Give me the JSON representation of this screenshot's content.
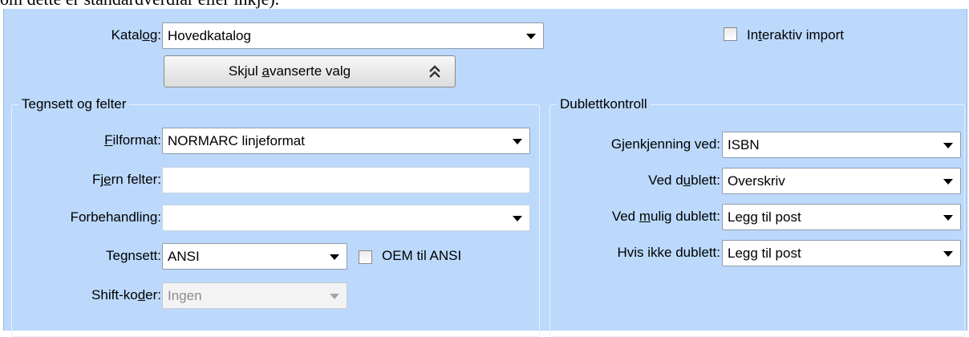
{
  "doc_text": "om dette er standardverdiar eller inkje).",
  "katalog": {
    "label_pre": "Katal",
    "label_ul": "o",
    "label_post": "g:",
    "value": "Hovedkatalog"
  },
  "interaktiv": {
    "label_pre": "In",
    "label_ul": "t",
    "label_post": "eraktiv import",
    "checked": false
  },
  "advanced_button": {
    "pre": "Skjul ",
    "ul": "a",
    "post": "vanserte valg",
    "icon": "double-chevron-up-icon"
  },
  "tegnsett_group": {
    "title": "Tegnsett og felter",
    "filformat": {
      "label_pre": "",
      "label_ul": "F",
      "label_post": "ilformat:",
      "value": "NORMARC linjeformat"
    },
    "fjern": {
      "label_pre": "Fj",
      "label_ul": "e",
      "label_post": "rn felter:",
      "value": ""
    },
    "forbehandling": {
      "label_pre": "Forbehandlin",
      "label_ul": "",
      "label_post": "g:",
      "value": ""
    },
    "tegnsett": {
      "label_pre": "Te",
      "label_ul": "g",
      "label_post": "nsett:",
      "value": "ANSI"
    },
    "oem": {
      "label": "OEM til ANSI",
      "checked": false
    },
    "shift": {
      "label_pre": "Shift-ko",
      "label_ul": "d",
      "label_post": "er:",
      "value": "Ingen"
    }
  },
  "dublett_group": {
    "title": "Dublettkontroll",
    "gjenkjenning": {
      "label_pre": "Gjenkjenning ved:",
      "label_ul": "",
      "label_post": "",
      "value": "ISBN"
    },
    "ved_dublett": {
      "label_pre": "Ved d",
      "label_ul": "u",
      "label_post": "blett:",
      "value": "Overskriv"
    },
    "ved_mulig": {
      "label_pre": "Ved ",
      "label_ul": "m",
      "label_post": "ulig dublett:",
      "value": "Legg til post"
    },
    "hvis_ikke": {
      "label_pre": "Hvis ikke dublett:",
      "label_ul": "",
      "label_post": "",
      "value": "Legg til post"
    }
  }
}
